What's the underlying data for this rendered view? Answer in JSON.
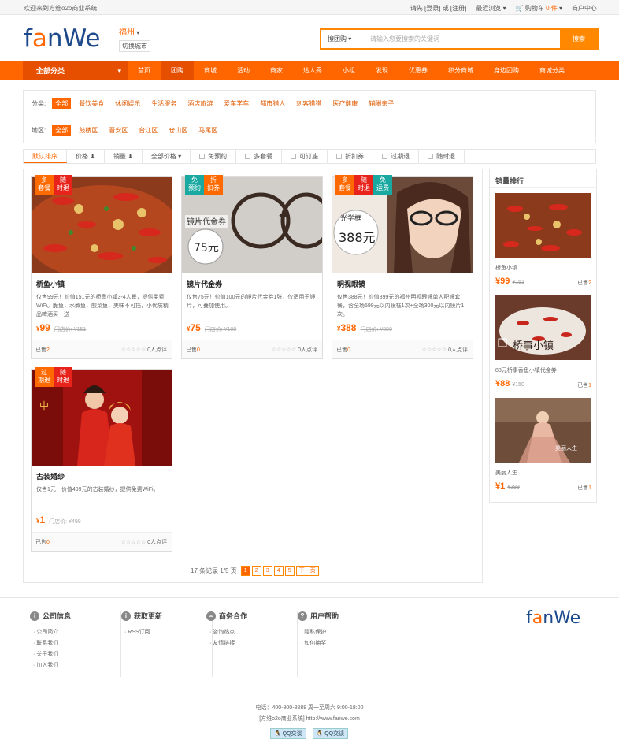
{
  "topbar": {
    "welcome": "欢迎来到方维o2o商业系统",
    "login_prompt": "请先 [登录] 或 [注册]",
    "recent": "最近浏览",
    "cart": "购物车",
    "cart_count": "0",
    "cart_unit": "件",
    "merchant": "商户中心"
  },
  "header": {
    "logo_a": "f",
    "logo_o": "a",
    "logo_b": "nWe",
    "city": "福州",
    "switch_city": "切换城市",
    "search_type": "搜团购",
    "search_placeholder": "请输入您要搜索的关键词",
    "search_button": "搜索"
  },
  "nav": {
    "all_categories": "全部分类",
    "items": [
      "首页",
      "团购",
      "商城",
      "活动",
      "商家",
      "达人秀",
      "小组",
      "发现",
      "优惠券",
      "积分商城",
      "身边团购",
      "商城分类"
    ],
    "active_index": 1
  },
  "filter": {
    "category_label": "分类:",
    "categories": [
      "全部",
      "餐饮美食",
      "休闲娱乐",
      "生活服务",
      "酒店旅游",
      "爱车学车",
      "都市猎人",
      "刺客猎猎",
      "医疗健康",
      "辅酬亲子"
    ],
    "area_label": "地区:",
    "areas": [
      "全部",
      "鼓楼区",
      "晋安区",
      "台江区",
      "仓山区",
      "马尾区"
    ]
  },
  "sort": {
    "default": "默认排序",
    "price": "价格 ⬇",
    "sales": "销量 ⬇",
    "all_price": "全部价格",
    "checks": [
      "免预约",
      "多套餐",
      "可订座",
      "折扣券",
      "过期退",
      "随时退"
    ]
  },
  "deals": [
    {
      "title": "桥鱼小镇",
      "desc": "仅售99元！价值151元的桥鱼小镇3-4人餐，提供免费WiFi。脆鱼，水煮鱼，酸菜鱼，美味不可挡，小优质精品啤酒买一送一",
      "currency": "¥",
      "price": "99",
      "orig_label": "门店价:",
      "orig": "¥151",
      "sold_label": "已售",
      "sold": "2",
      "reviews": "0人点评",
      "tags": [
        "多套餐",
        "随时退"
      ]
    },
    {
      "title": "镜片代金券",
      "desc": "仅售75元！价值100元的镜片代金券1张，仅适用于镜片，可叠加使用。",
      "currency": "¥",
      "price": "75",
      "orig_label": "门店价:",
      "orig": "¥100",
      "sold_label": "已售",
      "sold": "0",
      "reviews": "0人点评",
      "tags": [
        "免预约",
        "折扣券"
      ]
    },
    {
      "title": "明视眼镜",
      "desc": "仅售388元！价值899元的福州明视眼镜单人配镜套餐，含全场599元以内镜框1次+全场300元以内镜片1次。",
      "currency": "¥",
      "price": "388",
      "orig_label": "门店价:",
      "orig": "¥899",
      "sold_label": "已售",
      "sold": "0",
      "reviews": "0人点评",
      "tags": [
        "多套餐",
        "随时退",
        "免运费"
      ]
    },
    {
      "title": "古装婚纱",
      "desc": "仅售1元！价值499元的古装婚纱，提供免费WiFi。",
      "currency": "¥",
      "price": "1",
      "orig_label": "门店价:",
      "orig": "¥499",
      "sold_label": "已售",
      "sold": "0",
      "reviews": "0人点评",
      "tags": [
        "过期退",
        "随时退"
      ]
    }
  ],
  "pager": {
    "summary": "17 条记录 1/5 页",
    "pages": [
      "1",
      "2",
      "3",
      "4",
      "5"
    ],
    "next": "下一页"
  },
  "side": {
    "title": "销量排行",
    "items": [
      {
        "name": "桥鱼小镇",
        "price": "99",
        "orig": "¥151",
        "sold_label": "已售",
        "sold": "2"
      },
      {
        "name": "88元桥事香鱼小镇代金券",
        "price": "88",
        "orig": "¥150",
        "sold_label": "已售",
        "sold": "1"
      },
      {
        "name": "美丽人生",
        "price": "1",
        "orig": "¥399",
        "sold_label": "已售",
        "sold": "1"
      }
    ]
  },
  "footer": {
    "cols": [
      {
        "title": "公司信息",
        "icon": "i",
        "links": [
          "公司简介",
          "联系我们",
          "关于我们",
          "加入我们"
        ]
      },
      {
        "title": "获取更新",
        "icon": "i",
        "links": [
          "RSS订阅"
        ]
      },
      {
        "title": "商务合作",
        "icon": "∞",
        "links": [
          "咨询热点",
          "友情链接"
        ]
      },
      {
        "title": "用户帮助",
        "icon": "?",
        "links": [
          "隐私保护",
          "如何抽奖"
        ]
      }
    ],
    "logo_a": "f",
    "logo_o": "a",
    "logo_b": "nWe",
    "phone": "电话：400-800-8888 周一至周六 9:00-18:00",
    "copyright": "[方维o2o商业系统] http://www.fanwe.com",
    "qq": [
      "QQ交谈",
      "QQ交谈"
    ]
  },
  "colors": {
    "accent": "#ff6600",
    "brand": "#1e4a8c",
    "tag_orange": "#ff6a00",
    "tag_red": "#e8231b",
    "tag_teal": "#1aa9a0"
  }
}
